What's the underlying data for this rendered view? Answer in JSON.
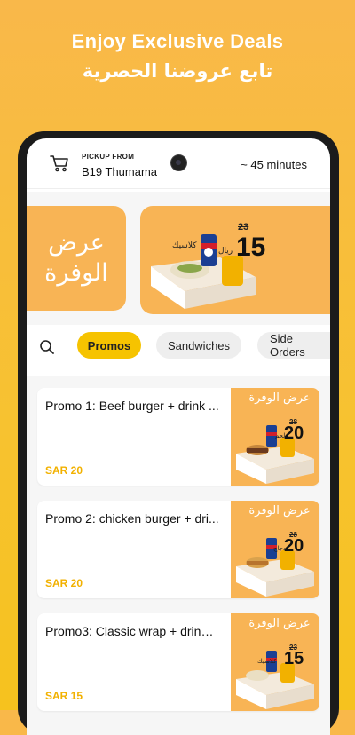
{
  "hero": {
    "title": "Enjoy Exclusive Deals",
    "subtitle": "تابع عروضنا الحصرية"
  },
  "header": {
    "pickup_label": "PICKUP FROM",
    "location": "B19 Thumama",
    "eta": "~ 45 minutes"
  },
  "banners": {
    "left_text": "عرض الوفرة",
    "right_price": "15",
    "right_old_price": "23",
    "right_currency": "ريال",
    "right_item": "كلاسيك"
  },
  "categories": {
    "tabs": [
      "Promos",
      "Sandwiches",
      "Side Orders"
    ],
    "active": "Promos"
  },
  "menu": {
    "items": [
      {
        "title": "Promo 1: Beef burger + drink ...",
        "price": "SAR 20",
        "img_headline": "عرض الوفرة",
        "img_price": "20",
        "img_old_price": "28",
        "img_item": "لحم"
      },
      {
        "title": "Promo 2: chicken burger + dri...",
        "price": "SAR 20",
        "img_headline": "عرض الوفرة",
        "img_price": "20",
        "img_old_price": "28",
        "img_item": "دجاج"
      },
      {
        "title": "Promo3: Classic wrap + drink ...",
        "price": "SAR 15",
        "img_headline": "عرض الوفرة",
        "img_price": "15",
        "img_old_price": "23",
        "img_item": "كلاسيك"
      }
    ]
  },
  "colors": {
    "background": "#f7c230",
    "accent": "#f6c300",
    "price": "#f2b100",
    "banner": "#f8b455"
  }
}
